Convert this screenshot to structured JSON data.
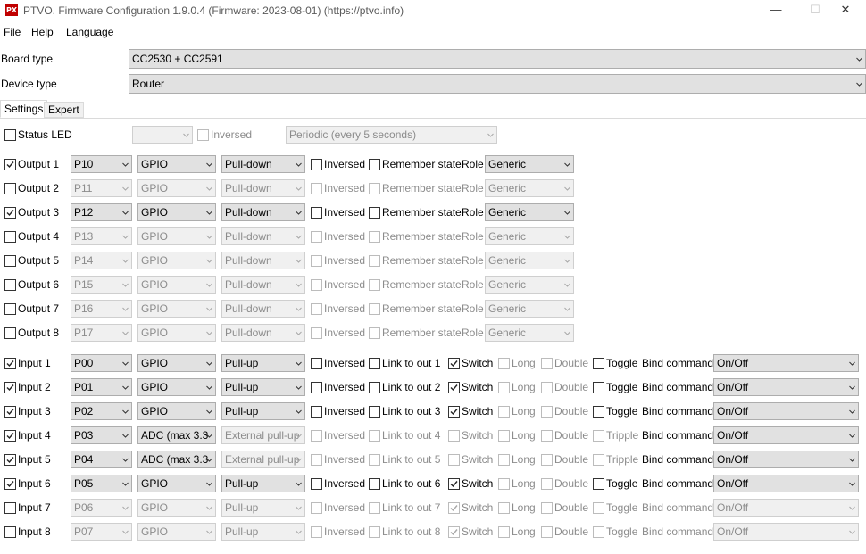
{
  "window": {
    "title": "PTVO. Firmware Configuration 1.9.0.4 (Firmware: 2023-08-01) (https://ptvo.info)",
    "icon_text": "PX",
    "minimize": "—",
    "maximize": "☐",
    "close": "✕"
  },
  "menu": [
    "File",
    "Help",
    "Language"
  ],
  "board": {
    "label": "Board type",
    "value": "CC2530 + CC2591"
  },
  "device": {
    "label": "Device type",
    "value": "Router"
  },
  "tabs": [
    "Settings",
    "Expert"
  ],
  "status_led": {
    "label": "Status LED",
    "pin": "",
    "inversed": "Inversed",
    "mode": "Periodic (every 5 seconds)"
  },
  "outputs": [
    {
      "label": "Output 1",
      "checked": true,
      "pin": "P10",
      "mode": "GPIO",
      "pull": "Pull-down",
      "inversed": "Inversed",
      "remember": "Remember state",
      "role_label": "Role",
      "role": "Generic"
    },
    {
      "label": "Output 2",
      "checked": false,
      "pin": "P11",
      "mode": "GPIO",
      "pull": "Pull-down",
      "inversed": "Inversed",
      "remember": "Remember state",
      "role_label": "Role",
      "role": "Generic"
    },
    {
      "label": "Output 3",
      "checked": true,
      "pin": "P12",
      "mode": "GPIO",
      "pull": "Pull-down",
      "inversed": "Inversed",
      "remember": "Remember state",
      "role_label": "Role",
      "role": "Generic"
    },
    {
      "label": "Output 4",
      "checked": false,
      "pin": "P13",
      "mode": "GPIO",
      "pull": "Pull-down",
      "inversed": "Inversed",
      "remember": "Remember state",
      "role_label": "Role",
      "role": "Generic"
    },
    {
      "label": "Output 5",
      "checked": false,
      "pin": "P14",
      "mode": "GPIO",
      "pull": "Pull-down",
      "inversed": "Inversed",
      "remember": "Remember state",
      "role_label": "Role",
      "role": "Generic"
    },
    {
      "label": "Output 6",
      "checked": false,
      "pin": "P15",
      "mode": "GPIO",
      "pull": "Pull-down",
      "inversed": "Inversed",
      "remember": "Remember state",
      "role_label": "Role",
      "role": "Generic"
    },
    {
      "label": "Output 7",
      "checked": false,
      "pin": "P16",
      "mode": "GPIO",
      "pull": "Pull-down",
      "inversed": "Inversed",
      "remember": "Remember state",
      "role_label": "Role",
      "role": "Generic"
    },
    {
      "label": "Output 8",
      "checked": false,
      "pin": "P17",
      "mode": "GPIO",
      "pull": "Pull-down",
      "inversed": "Inversed",
      "remember": "Remember state",
      "role_label": "Role",
      "role": "Generic"
    }
  ],
  "inputs": [
    {
      "label": "Input 1",
      "checked": true,
      "pin": "P00",
      "mode": "GPIO",
      "pull": "Pull-up",
      "pull_enabled": true,
      "inversed": "Inversed",
      "link": "Link to out 1",
      "switch": "Switch",
      "switch_checked": true,
      "long": "Long",
      "double": "Double",
      "toggle": "Toggle",
      "bind_label": "Bind command",
      "bind": "On/Off"
    },
    {
      "label": "Input 2",
      "checked": true,
      "pin": "P01",
      "mode": "GPIO",
      "pull": "Pull-up",
      "pull_enabled": true,
      "inversed": "Inversed",
      "link": "Link to out 2",
      "switch": "Switch",
      "switch_checked": true,
      "long": "Long",
      "double": "Double",
      "toggle": "Toggle",
      "bind_label": "Bind command",
      "bind": "On/Off"
    },
    {
      "label": "Input 3",
      "checked": true,
      "pin": "P02",
      "mode": "GPIO",
      "pull": "Pull-up",
      "pull_enabled": true,
      "inversed": "Inversed",
      "link": "Link to out 3",
      "switch": "Switch",
      "switch_checked": true,
      "long": "Long",
      "double": "Double",
      "toggle": "Toggle",
      "bind_label": "Bind command",
      "bind": "On/Off"
    },
    {
      "label": "Input 4",
      "checked": true,
      "pin": "P03",
      "mode": "ADC (max 3.3",
      "pull": "External pull-up",
      "pull_enabled": false,
      "inversed": "Inversed",
      "link": "Link to out 4",
      "switch": "Switch",
      "switch_checked": false,
      "long": "Long",
      "double": "Double",
      "toggle": "Tripple",
      "bind_label": "Bind command",
      "bind": "On/Off"
    },
    {
      "label": "Input 5",
      "checked": true,
      "pin": "P04",
      "mode": "ADC (max 3.3",
      "pull": "External pull-up",
      "pull_enabled": false,
      "inversed": "Inversed",
      "link": "Link to out 5",
      "switch": "Switch",
      "switch_checked": false,
      "long": "Long",
      "double": "Double",
      "toggle": "Tripple",
      "bind_label": "Bind command",
      "bind": "On/Off"
    },
    {
      "label": "Input 6",
      "checked": true,
      "pin": "P05",
      "mode": "GPIO",
      "pull": "Pull-up",
      "pull_enabled": true,
      "inversed": "Inversed",
      "link": "Link to out 6",
      "switch": "Switch",
      "switch_checked": true,
      "long": "Long",
      "double": "Double",
      "toggle": "Toggle",
      "bind_label": "Bind command",
      "bind": "On/Off"
    },
    {
      "label": "Input 7",
      "checked": false,
      "pin": "P06",
      "mode": "GPIO",
      "pull": "Pull-up",
      "pull_enabled": true,
      "inversed": "Inversed",
      "link": "Link to out 7",
      "switch": "Switch",
      "switch_checked": true,
      "long": "Long",
      "double": "Double",
      "toggle": "Toggle",
      "bind_label": "Bind command",
      "bind": "On/Off"
    },
    {
      "label": "Input 8",
      "checked": false,
      "pin": "P07",
      "mode": "GPIO",
      "pull": "Pull-up",
      "pull_enabled": true,
      "inversed": "Inversed",
      "link": "Link to out 8",
      "switch": "Switch",
      "switch_checked": true,
      "long": "Long",
      "double": "Double",
      "toggle": "Toggle",
      "bind_label": "Bind command",
      "bind": "On/Off"
    }
  ]
}
